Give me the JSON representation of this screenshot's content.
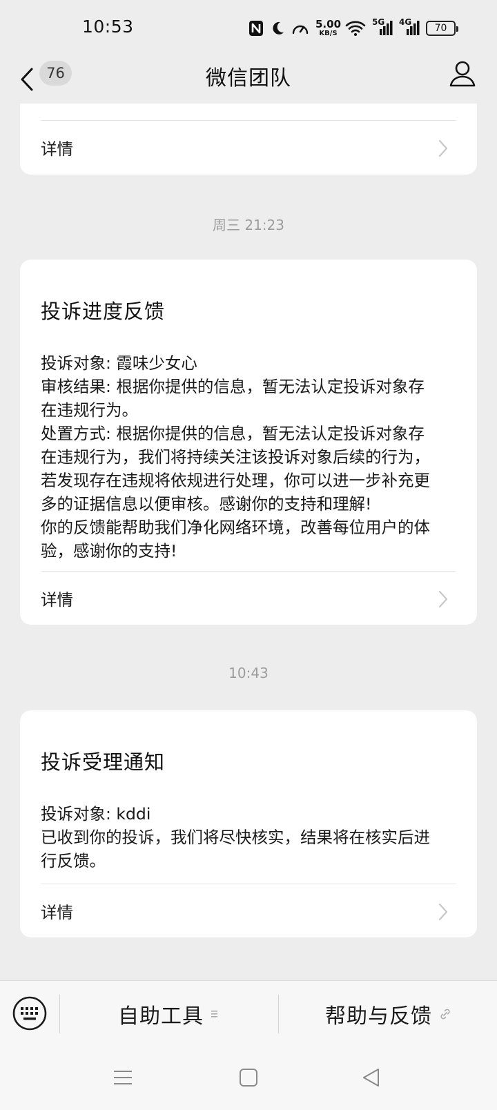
{
  "status_bar": {
    "time": "10:53",
    "net_speed_value": "5.00",
    "net_speed_unit": "KB/S",
    "signal_1": "5G",
    "signal_2": "4G",
    "battery": "70",
    "icons": [
      "nfc-icon",
      "moon-icon",
      "speed-icon",
      "wifi-icon",
      "signal-5g-icon",
      "signal-4g-icon",
      "battery-icon"
    ]
  },
  "header": {
    "unread_count": "76",
    "title": "微信团队"
  },
  "messages": [
    {
      "detail_label": "详情"
    },
    {
      "timestamp": "周三 21:23",
      "title": "投诉进度反馈",
      "body_lines": [
        "投诉对象: 霞味少女心",
        "审核结果: 根据你提供的信息，暂无法认定投诉对象存",
        "在违规行为。",
        "处置方式: 根据你提供的信息，暂无法认定投诉对象存",
        "在违规行为，我们将持续关注该投诉对象后续的行为，",
        "若发现存在违规将依规进行处理，你可以进一步补充更",
        "多的证据信息以便审核。感谢你的支持和理解!",
        "你的反馈能帮助我们净化网络环境，改善每位用户的体",
        "验，感谢你的支持!"
      ],
      "detail_label": "详情"
    },
    {
      "timestamp": "10:43",
      "title": "投诉受理通知",
      "body_lines": [
        "投诉对象: kddi",
        "已收到你的投诉，我们将尽快核实，结果将在核实后进",
        "行反馈。"
      ],
      "detail_label": "详情"
    }
  ],
  "menu": {
    "item_1": "自助工具",
    "item_2": "帮助与反馈"
  },
  "colors": {
    "page_bg": "#ededed",
    "card_bg": "#ffffff",
    "timestamp": "#9c9c9c"
  }
}
